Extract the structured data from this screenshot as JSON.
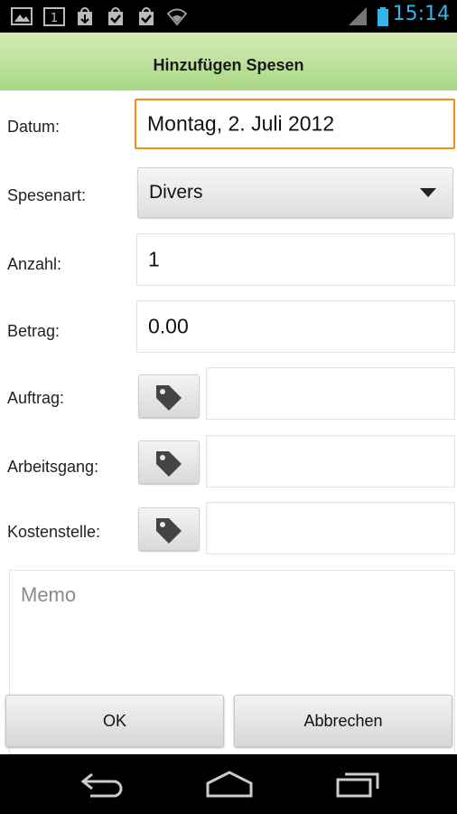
{
  "status_bar": {
    "time": "15:14",
    "icons": [
      "gallery-icon",
      "calendar-icon",
      "download-icon",
      "shopping-bag-icon",
      "shopping-bag-check-icon",
      "wifi-icon",
      "signal-icon",
      "battery-icon"
    ],
    "accent_color": "#33b5e5"
  },
  "title_bar": {
    "title": "Hinzufügen Spesen",
    "color_top": "#d4ecb5",
    "color_bottom": "#a9d785"
  },
  "form": {
    "datum": {
      "label": "Datum:",
      "value": "Montag, 2. Juli 2012"
    },
    "spesenart": {
      "label": "Spesenart:",
      "value": "Divers"
    },
    "anzahl": {
      "label": "Anzahl:",
      "value": "1"
    },
    "betrag": {
      "label": "Betrag:",
      "value": "0.00"
    },
    "auftrag": {
      "label": "Auftrag:",
      "value": ""
    },
    "arbeitsgang": {
      "label": "Arbeitsgang:",
      "value": ""
    },
    "kostenstelle": {
      "label": "Kostenstelle:",
      "value": ""
    },
    "memo": {
      "placeholder": "Memo",
      "value": ""
    }
  },
  "actions": {
    "ok_label": "OK",
    "cancel_label": "Abbrechen"
  },
  "nav_bar": {
    "icons": [
      "back-icon",
      "home-icon",
      "recent-apps-icon"
    ]
  }
}
